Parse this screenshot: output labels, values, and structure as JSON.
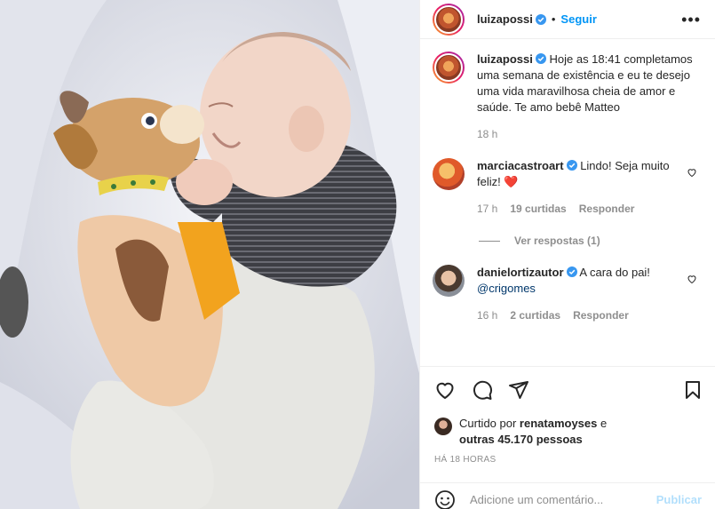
{
  "post": {
    "author": "luizapossi",
    "follow_label": "Seguir",
    "dot": "•",
    "more_label": "•••",
    "caption": "Hoje as 18:41 completamos uma semana de existência e eu te desejo uma vida maravilhosa cheia de amor e saúde. Te amo bebê Matteo",
    "caption_time": "18 h"
  },
  "comments": [
    {
      "user": "marciacastroart",
      "text": "Lindo! Seja muito feliz! ",
      "emoji": "❤️",
      "time": "17 h",
      "likes": "19 curtidas",
      "reply": "Responder",
      "view_replies": "Ver respostas (1)"
    },
    {
      "user": "danielortizautor",
      "text": "A cara do pai!",
      "mention": "@crigomes",
      "time": "16 h",
      "likes": "2 curtidas",
      "reply": "Responder"
    }
  ],
  "likes": {
    "prefix": "Curtido por ",
    "user": "renatamoyses",
    "middle": " e",
    "others": "outras 45.170 pessoas"
  },
  "timestamp": "HÁ 18 HORAS",
  "composer": {
    "placeholder": "Adicione um comentário...",
    "publish": "Publicar"
  },
  "colors": {
    "accent": "#0095f6",
    "verified": "#3897f0",
    "heart": "#ed4956",
    "secondary": "#8e8e8e"
  }
}
